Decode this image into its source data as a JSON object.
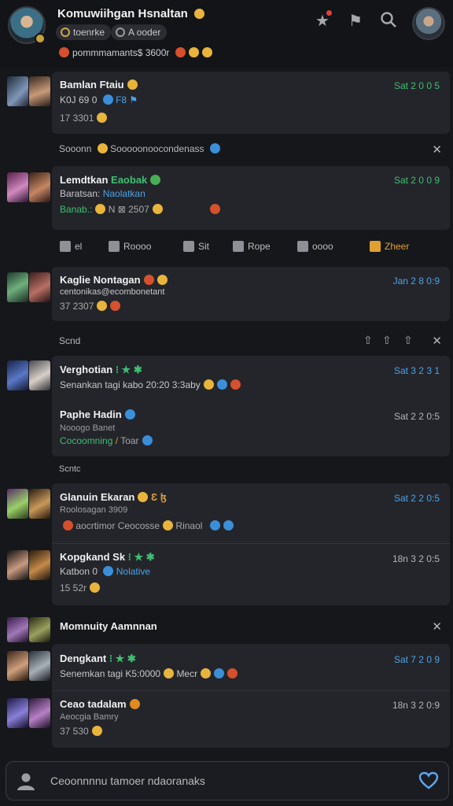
{
  "header": {
    "title": "Komuwiihgan Hsnaltan",
    "chip_a": "toenrke",
    "chip_b": "A ooder",
    "status": "pommmamants$ 3600r"
  },
  "feed": [
    {
      "name": "Bamlan Ftaiu",
      "sub": "K0J 69 0",
      "sub_accent": "F8 ⚑",
      "meta": "17 3301",
      "time": "Sat 2 0 0 5",
      "time_color": "green"
    },
    {
      "name": "Lemdtkan",
      "name_accent": "Eaobak",
      "sub": "Baratsan:",
      "sub_accent": "Naolatkan",
      "meta": "Banab.:",
      "meta2": "N ⊠ 2507",
      "time": "Sat 2 0 0 9",
      "time_color": "green"
    },
    {
      "name": "Kaglie Nontagan",
      "sub": "centonikas@ecombonetant",
      "meta": "37 2307",
      "time": "Jan 2 8 0:9",
      "time_color": "blue"
    },
    {
      "name": "Verghotian",
      "sub": "Senankan tagi kabo 20:20 3:3aby",
      "time": "Sat 3 2 3 1",
      "time_color": "blue"
    },
    {
      "name": "Paphe Hadin",
      "sub": "Nooogo Banet",
      "sub_accent": "Cocoomning",
      "meta": "Toar",
      "time": "Sat 2 2 0:5",
      "time_color": "green"
    },
    {
      "name": "Glanuin Ekaran",
      "sub": "Roolosagan 3909",
      "meta": "aocrtimor Ceocosse",
      "meta2": "Rinaol",
      "time": "Sat 2 2 0:5",
      "time_color": "blue"
    },
    {
      "name": "Kopgkand Sk",
      "sub": "Katbon 0",
      "sub_accent": "Nolative",
      "meta": "15 52r",
      "time": "18n 3 2 0:5",
      "time_color": "gray"
    },
    {
      "name": "Dengkant",
      "sub": "Senemkan tagi K5:0000",
      "sub_accent": "Mecr",
      "time": "Sat 7 2 0 9",
      "time_color": "blue"
    },
    {
      "name": "Ceao tadalam",
      "sub": "Aeocgia Bamry",
      "meta": "37 530",
      "time": "18n 3 2 0:9",
      "time_color": "gray"
    }
  ],
  "sections": {
    "s1": "Sooonn",
    "s1_text": "Sooooonoocondenass",
    "s2": "Scnd",
    "s3": "Scntc",
    "s4": "Momnuity Aamnnan"
  },
  "actions": {
    "a1": "el",
    "a2": "Roooo",
    "a3": "Sit",
    "a4": "Rope",
    "a5": "oooo",
    "a6": "Zheer"
  },
  "composer": {
    "placeholder": "Ceoonnnnu tamoer ndaoranaks"
  },
  "colors": {
    "background": "#16171b",
    "card": "#23252b",
    "green": "#3fbf6f",
    "blue": "#4aa3e6",
    "accent_orange": "#e0a030"
  }
}
